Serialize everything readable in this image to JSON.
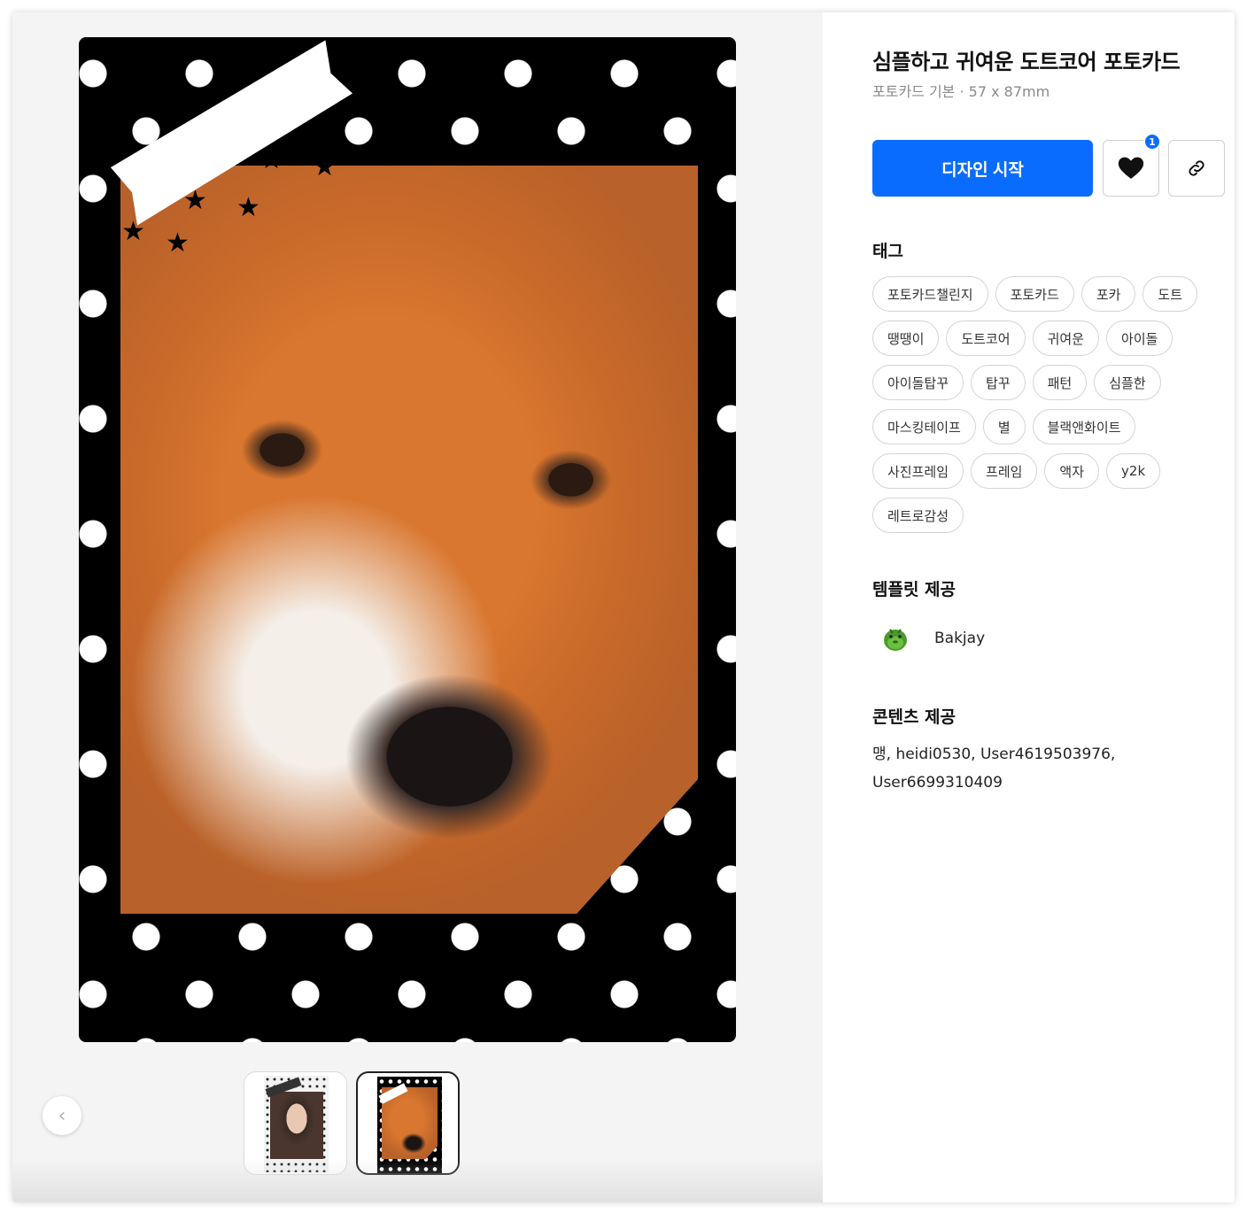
{
  "product": {
    "title": "심플하고 귀여운 도트코어 포토카드",
    "subtitle": "포토카드 기본 · 57 x 87mm"
  },
  "actions": {
    "start_label": "디자인 시작",
    "like_count": "1"
  },
  "sections": {
    "tags_title": "태그",
    "template_title": "템플릿 제공",
    "contents_title": "콘텐츠 제공"
  },
  "tags": [
    "포토카드챌린지",
    "포토카드",
    "포카",
    "도트",
    "땡땡이",
    "도트코어",
    "귀여운",
    "아이돌",
    "아이돌탑꾸",
    "탑꾸",
    "패턴",
    "심플한",
    "마스킹테이프",
    "별",
    "블랙앤화이트",
    "사진프레임",
    "프레임",
    "액자",
    "y2k",
    "레트로감성"
  ],
  "template_provider": {
    "name": "Bakjay"
  },
  "contents_providers": "맹, heidi0530, User4619503976, User6699310409",
  "gallery": {
    "selected_index": 1
  },
  "icons": {
    "prev": "chevron-left-icon",
    "like": "heart-icon",
    "share": "link-icon"
  },
  "colors": {
    "accent": "#0a6cff",
    "card_bg": "#000000",
    "dot": "#ffffff"
  }
}
